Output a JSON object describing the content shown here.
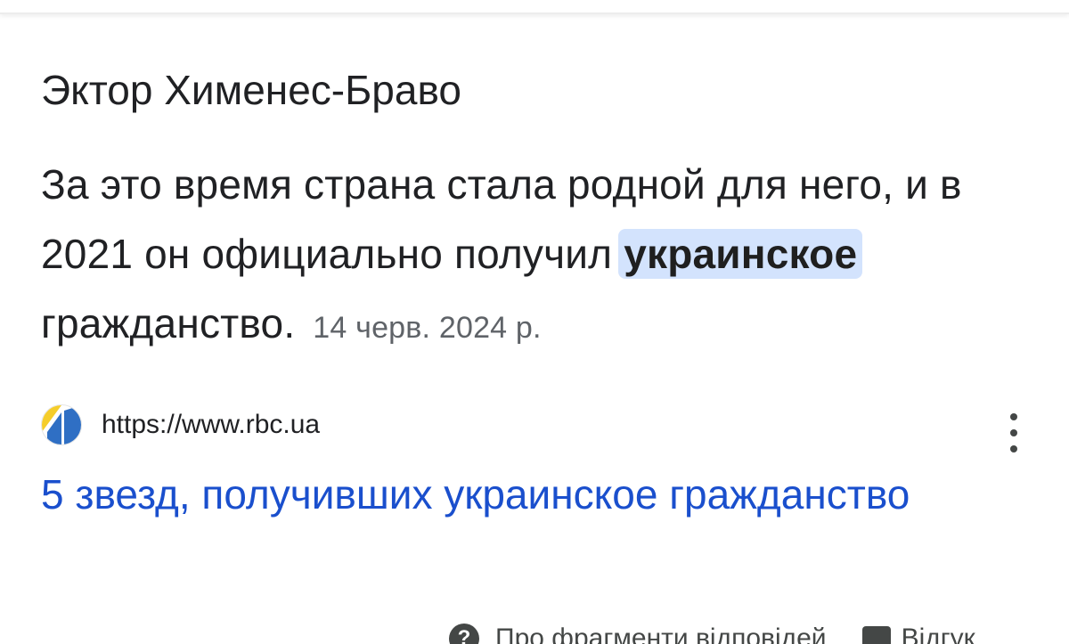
{
  "featured_snippet": {
    "entity_title": "Эктор Хименес-Браво",
    "text_before_highlight": "За это время страна стала родной для него, и в 2021 он официально получил ",
    "highlight": "украинское",
    "text_after_highlight": " гражданство.",
    "date": "14 черв. 2024 р."
  },
  "source": {
    "favicon": "rbc-favicon-icon",
    "url": "https://www.rbc.ua",
    "menu_icon": "more-vert-icon"
  },
  "result": {
    "title": "5 звезд, получивших украинское гражданство"
  },
  "footer": {
    "about_icon": "help-circle-icon",
    "about_label": "Про фрагменти відповідей",
    "feedback_icon": "feedback-icon",
    "feedback_label": "Відгук"
  },
  "colors": {
    "highlight_bg": "#d3e3fd",
    "link": "#1a4fcd",
    "muted": "#5f6368",
    "favicon_yellow": "#f5cd2a",
    "favicon_blue": "#2f6fc4"
  }
}
